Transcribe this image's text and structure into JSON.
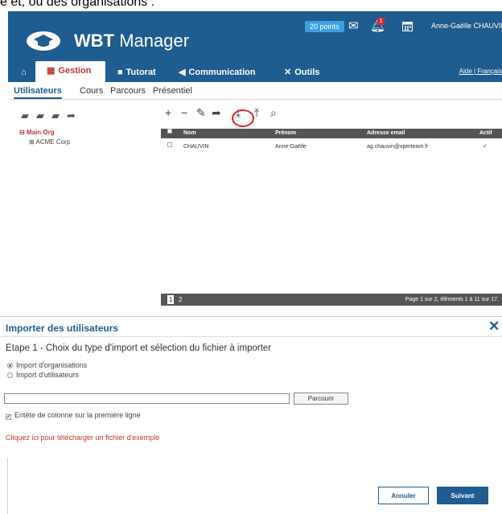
{
  "caption": "e et, ou des organisations :",
  "header": {
    "app_name_bold": "WBT",
    "app_name_rest": " Manager",
    "points": "20 points",
    "notification_count": "1",
    "username": "Anne-Gaëlle CHAUVIN",
    "icons": [
      "logo-cap-icon",
      "mail-icon",
      "bell-icon",
      "calendar-icon"
    ]
  },
  "nav": {
    "home_icon": "⌂",
    "items": [
      "Gestion",
      "Tutorat",
      "Communication",
      "Outils"
    ],
    "help": "Aide",
    "separator": "|",
    "lang": "Français"
  },
  "subnav": {
    "items": [
      "Utilisateurs",
      "Cours",
      "Parcours",
      "Présentiel"
    ]
  },
  "tree": {
    "root": "Main Org",
    "child": "ACME Corp"
  },
  "grid": {
    "columns": [
      "Nom",
      "Prénom",
      "Adresse email",
      "Actif"
    ],
    "rows": [
      {
        "nom": "CHAUVIN",
        "prenom": "Anne-Gaëlle",
        "email": "ag.chauvin@xperteam.fr",
        "actif": true
      }
    ],
    "pages": [
      "1",
      "2"
    ],
    "pager_info": "Page 1 sur 2, éléments 1 à 11 sur 17."
  },
  "dialog": {
    "title": "Importer des utilisateurs",
    "close": "✕",
    "step": "Etape 1 - Choix du type d'import et sélection du fichier à importer",
    "options": [
      "Import d'organisations",
      "Import d'utilisateurs"
    ],
    "selected_option": 0,
    "file_value": "",
    "browse": "Parcourir",
    "header_checkbox": "Entête de colonne sur la première ligne",
    "header_checked": true,
    "download_link": "Cliquez ici pour télécharger un fichier d'exemple",
    "cancel": "Annuler",
    "next": "Suivant"
  },
  "colors": {
    "brand": "#1f5c8f",
    "accent": "#c0392b",
    "highlight": "#e02020"
  }
}
